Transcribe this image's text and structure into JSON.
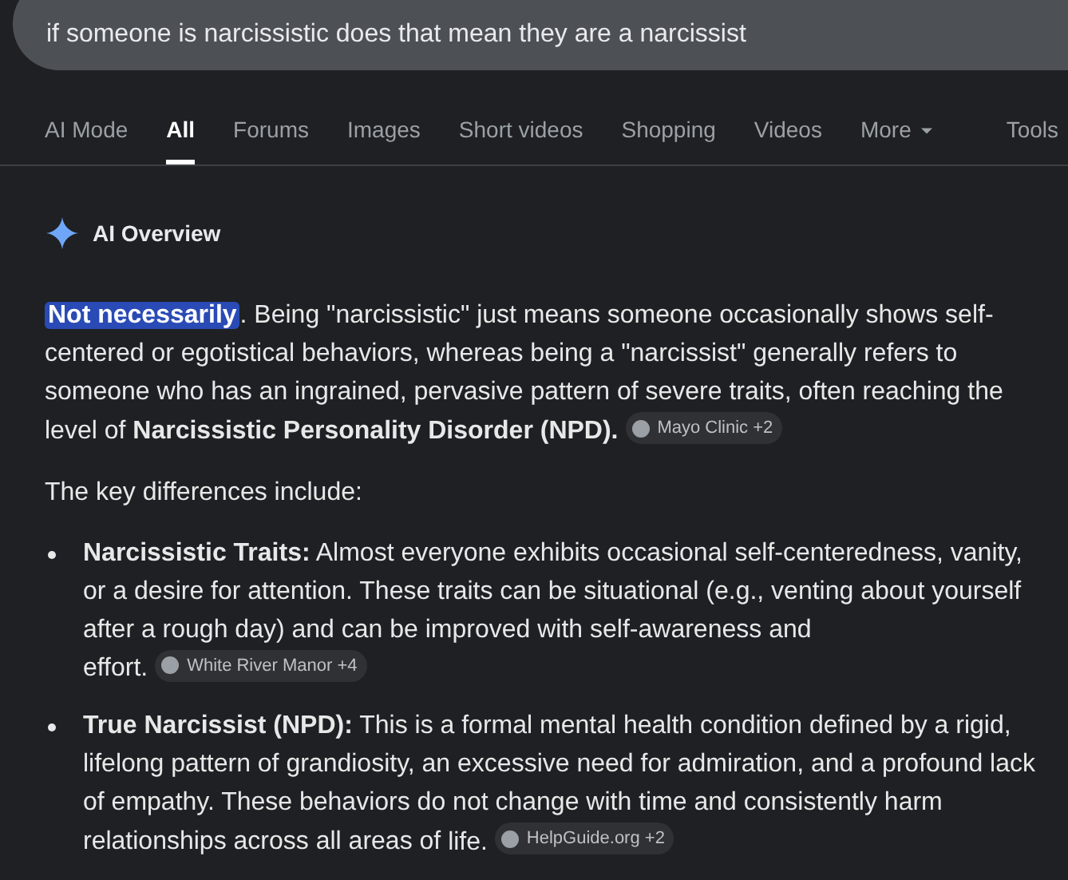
{
  "search": {
    "value": "if someone is narcissistic does that mean they are a narcissist"
  },
  "tabs": [
    {
      "label": "AI Mode",
      "selected": false,
      "kind": "tab"
    },
    {
      "label": "All",
      "selected": true,
      "kind": "tab"
    },
    {
      "label": "Forums",
      "selected": false,
      "kind": "tab"
    },
    {
      "label": "Images",
      "selected": false,
      "kind": "tab"
    },
    {
      "label": "Short videos",
      "selected": false,
      "kind": "tab"
    },
    {
      "label": "Shopping",
      "selected": false,
      "kind": "tab"
    },
    {
      "label": "Videos",
      "selected": false,
      "kind": "tab"
    },
    {
      "label": "More",
      "selected": false,
      "kind": "menu"
    },
    {
      "label": "Tools",
      "selected": false,
      "kind": "tools"
    }
  ],
  "overview": {
    "title": "AI Overview",
    "intro": {
      "highlight": "Not necessarily",
      "text": ". Being \"narcissistic\" just means someone occasionally shows self-centered or egotistical behaviors, whereas being a \"narcissist\" generally refers to someone who has an ingrained, pervasive pattern of severe traits, often reaching the level of **Narcissistic Personality Disorder (NPD).**",
      "source": "Mayo Clinic +2"
    },
    "lead": "The key differences include:",
    "bullets": [
      {
        "text": "**Narcissistic Traits:** Almost everyone exhibits occasional self-centeredness, vanity, or a desire for attention. These traits can be situational (e.g., venting about yourself after a rough day) and can be improved with self-awareness and effort.",
        "source": "White River Manor +4"
      },
      {
        "text": "**True Narcissist (NPD):** This is a formal mental health condition defined by a rigid, lifelong pattern of grandiosity, an excessive need for admiration, and a profound lack of empathy. These behaviors do not change with time and consistently harm relationships across all areas of life.",
        "source": "HelpGuide.org +2"
      }
    ]
  }
}
